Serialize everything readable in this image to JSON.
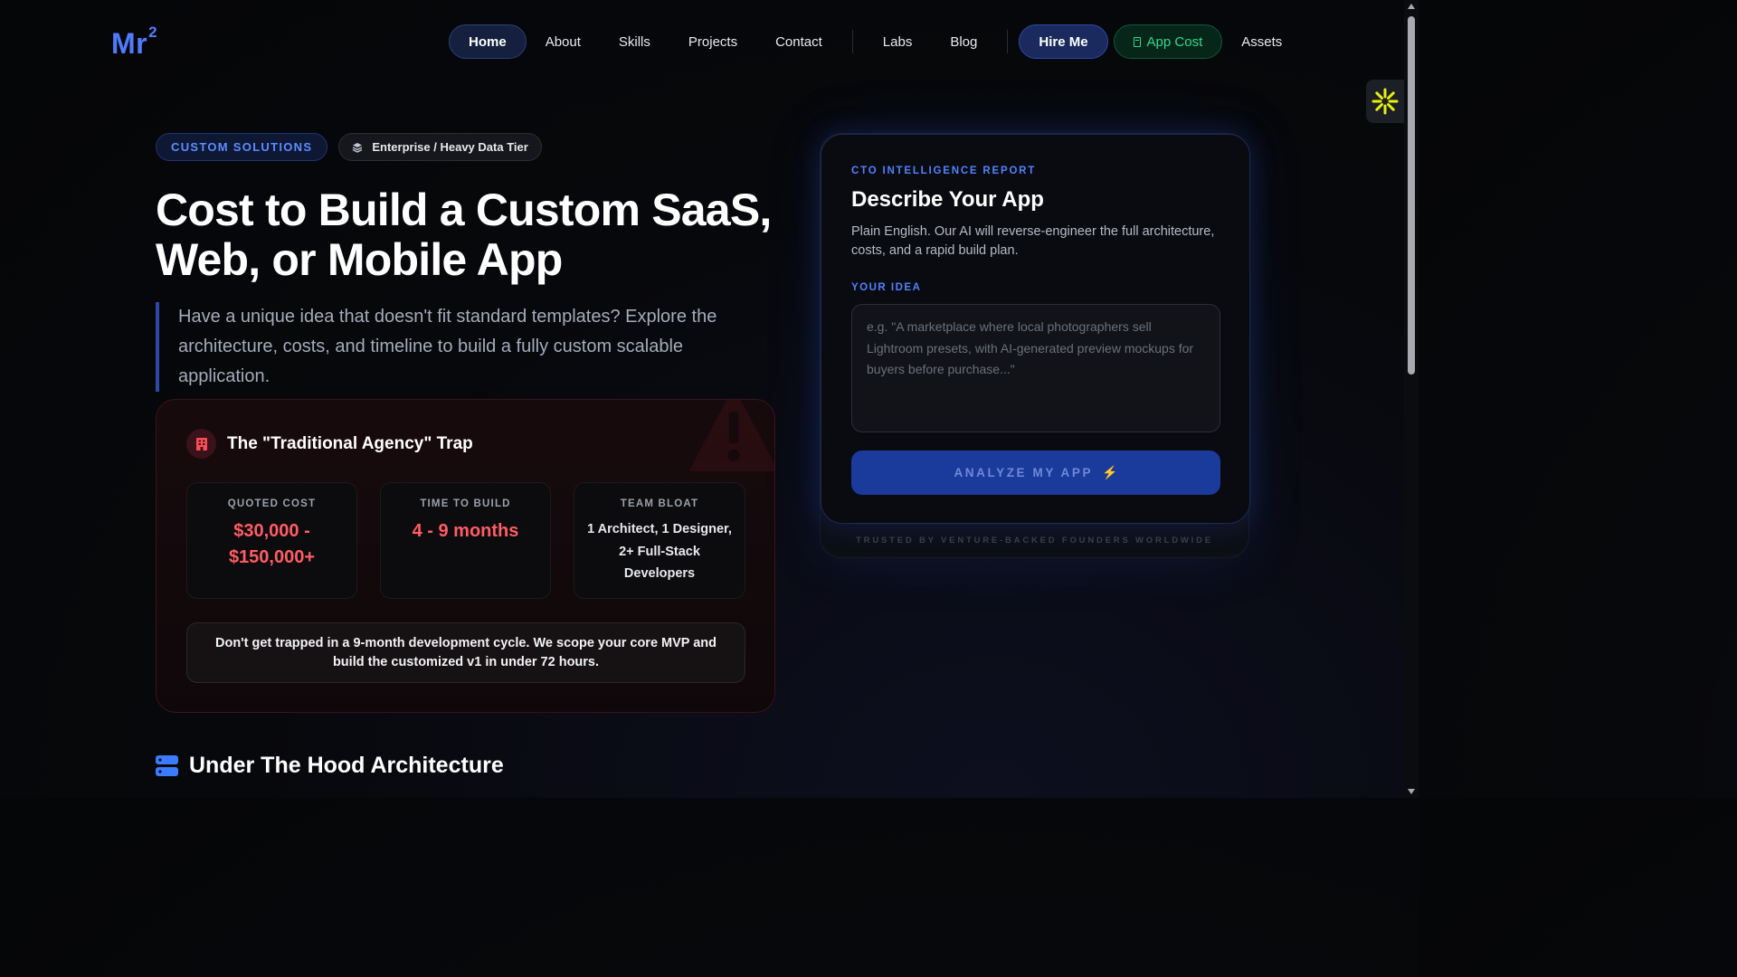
{
  "nav": {
    "logo": "Mr",
    "logo_sup": "2",
    "links": [
      "Home",
      "About",
      "Skills",
      "Projects",
      "Contact",
      "Labs",
      "Blog"
    ],
    "hire": "Hire Me",
    "app_cost": "App Cost",
    "assets": "Assets"
  },
  "hero": {
    "badge_primary": "CUSTOM SOLUTIONS",
    "badge_secondary": "Enterprise / Heavy Data Tier",
    "title_line1": "Cost to Build a Custom SaaS,",
    "title_line2": "Web, or Mobile App",
    "description": "Have a unique idea that doesn't fit standard templates? Explore the architecture, costs, and timeline to build a fully custom scalable application."
  },
  "trap": {
    "title": "The \"Traditional Agency\" Trap",
    "stats": [
      {
        "label": "QUOTED COST",
        "line1": "$30,000 -",
        "line2": "$150,000+"
      },
      {
        "label": "TIME TO BUILD",
        "line1": "4 - 9 months"
      },
      {
        "label": "TEAM BLOAT",
        "line1": "1 Architect, 1 Designer,",
        "line2": "2+ Full-Stack",
        "line3": "Developers"
      }
    ],
    "note": "Don't get trapped in a 9-month development cycle. We scope your core MVP and build the customized v1 in under 72 hours."
  },
  "architecture": {
    "title": "Under The Hood Architecture"
  },
  "cto": {
    "kicker": "CTO INTELLIGENCE REPORT",
    "title": "Describe Your App",
    "description": "Plain English. Our AI will reverse-engineer the full architecture, costs, and a rapid build plan.",
    "idea_label": "YOUR IDEA",
    "idea_placeholder": "e.g. \"A marketplace where local photographers sell Lightroom presets, with AI-generated preview mockups for buyers before purchase...\"",
    "idea_value": "",
    "button": "ANALYZE MY APP",
    "footer": "TRUSTED BY VENTURE-BACKED FOUNDERS WORLDWIDE"
  },
  "icons": {
    "accessibility": "accessibility-icon",
    "layers": "layers-icon",
    "building": "building-icon",
    "warning": "warning-icon",
    "server": "server-icon",
    "bolt": "bolt-icon",
    "app_cost": "receipt-icon"
  },
  "colors": {
    "accent_blue": "#4f7bff",
    "danger_red": "#ff5c64",
    "success_green": "#34d98b",
    "background": "#07080b"
  }
}
